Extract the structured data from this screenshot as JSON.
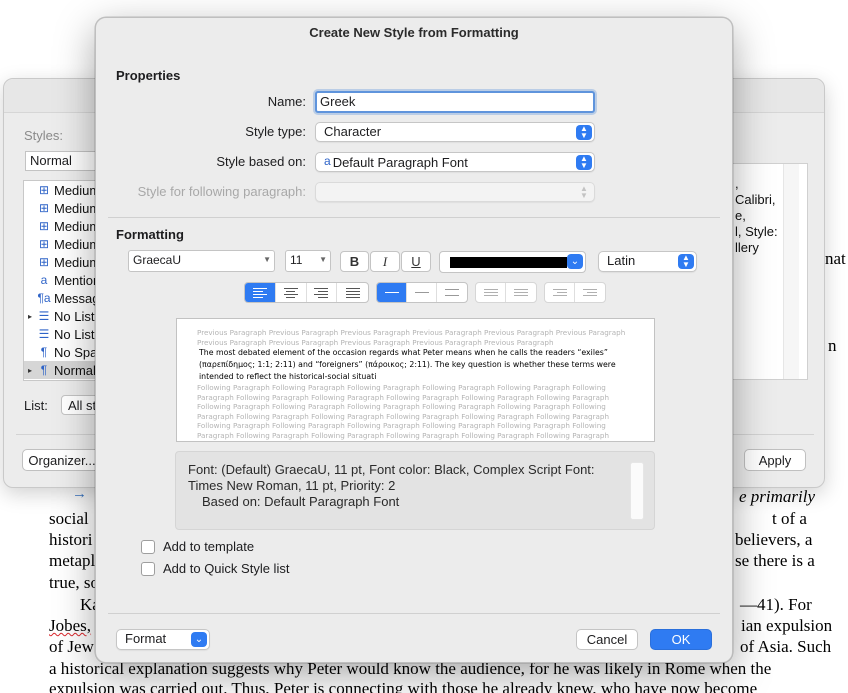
{
  "document": {
    "fragments_right": {
      "primarily": "e primarily",
      "of_a": "t of a",
      "believers": "believers, a",
      "there_is": "se there is a",
      "forty_one": "—41). For",
      "expulsion": "ian expulsion",
      "asia": "of Asia. Such",
      "nat": "nat",
      "n": "n"
    },
    "fragments_left": {
      "social": "social",
      "histori": "histori",
      "metapl": "metapl",
      "true": "true, so",
      "ka": "Ka",
      "jobes": "Jobes,",
      "of_jew": "of Jew"
    },
    "full_lines": [
      "a historical explanation suggests why Peter would know the audience, for he was likely in Rome when the",
      "expulsion was carried out. Thus, Peter is connecting with those he already knew, who have now become"
    ]
  },
  "styles_window": {
    "styles_label": "Styles:",
    "current_style": "Normal",
    "list_items": [
      {
        "icon": "table-style-icon",
        "glyph": "⊞",
        "label": "Medium"
      },
      {
        "icon": "table-style-icon",
        "glyph": "⊞",
        "label": "Medium"
      },
      {
        "icon": "table-style-icon",
        "glyph": "⊞",
        "label": "Medium"
      },
      {
        "icon": "table-style-icon",
        "glyph": "⊞",
        "label": "Medium"
      },
      {
        "icon": "table-style-icon",
        "glyph": "⊞",
        "label": "Medium"
      },
      {
        "icon": "character-style-icon",
        "glyph": "a",
        "label": "Mention"
      },
      {
        "icon": "linked-style-icon",
        "glyph": "¶a",
        "label": "Messag"
      },
      {
        "icon": "list-style-icon",
        "glyph": "☰",
        "label": "No List"
      },
      {
        "icon": "list-style-icon",
        "glyph": "☰",
        "label": "No List"
      },
      {
        "icon": "paragraph-style-icon",
        "glyph": "¶",
        "label": "No Spa"
      },
      {
        "icon": "paragraph-style-icon",
        "glyph": "¶",
        "label": "Normal"
      }
    ],
    "description_text": [
      ",",
      "Calibri,",
      "",
      "e,",
      "l, Style:",
      "llery"
    ],
    "list_label": "List:",
    "list_value": "All st",
    "organizer_label": "Organizer...",
    "apply_label": "Apply"
  },
  "dialog": {
    "title": "Create New Style from Formatting",
    "properties_heading": "Properties",
    "name_label": "Name:",
    "name_value": "Greek",
    "style_type_label": "Style type:",
    "style_type_value": "Character",
    "based_on_label": "Style based on:",
    "based_on_value": "Default Paragraph Font",
    "following_label": "Style for following paragraph:",
    "following_value": "",
    "formatting_heading": "Formatting",
    "font_name": "GraecaU",
    "font_size": "11",
    "bold": "B",
    "italic": "I",
    "underline": "U",
    "font_color": "#000000",
    "script": "Latin",
    "preview": {
      "previous": "Previous Paragraph Previous Paragraph Previous Paragraph Previous Paragraph Previous Paragraph Previous Paragraph Previous Paragraph Previous Paragraph Previous Paragraph Previous Paragraph Previous Paragraph",
      "current": "The most debated element of the occasion regards what Peter means when he calls the readers “exiles” (παρεπίδημος; 1:1; 2:11) and “foreigners” (πάροικος; 2:11). The key question is whether these terms were intended to reflect the historical-social situati",
      "following": "Following Paragraph Following Paragraph Following Paragraph Following Paragraph Following Paragraph Following Paragraph Following Paragraph Following Paragraph Following Paragraph Following Paragraph Following Paragraph Following Paragraph Following Paragraph Following Paragraph Following Paragraph Following Paragraph Following Paragraph Following Paragraph Following Paragraph Following Paragraph Following Paragraph Following Paragraph Following Paragraph Following Paragraph Following Paragraph Following Paragraph Following Paragraph Following Paragraph Following Paragraph Following Paragraph Following Paragraph Following Paragraph Following Paragraph Following Paragraph Following Paragraph Following Paragraph Following Paragraph Following Paragraph Following Paragraph Following Paragraph Following Paragraph Following Paragraph"
    },
    "description_line1": "Font: (Default) GraecaU, 11 pt, Font color: Black, Complex Script Font: Times New Roman, 11 pt, Priority: 2",
    "description_line2": "Based on: Default Paragraph Font",
    "add_to_template": "Add to template",
    "add_to_quick_style": "Add to Quick Style list",
    "format_label": "Format",
    "cancel_label": "Cancel",
    "ok_label": "OK"
  },
  "colors": {
    "accent": "#2f7bf2",
    "focus_ring": "#5f94dc"
  }
}
